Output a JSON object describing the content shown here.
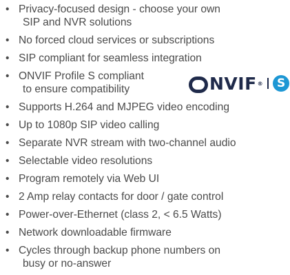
{
  "features": [
    {
      "lines": [
        "Privacy-focused design - choose your own",
        "SIP and NVR solutions"
      ]
    },
    {
      "lines": [
        "No forced cloud services or subscriptions"
      ]
    },
    {
      "lines": [
        "SIP compliant for seamless integration"
      ]
    },
    {
      "lines": [
        "ONVIF Profile S compliant",
        "to ensure compatibility"
      ],
      "logo": true
    },
    {
      "lines": [
        "Supports H.264 and MJPEG video encoding"
      ]
    },
    {
      "lines": [
        "Up to 1080p SIP video calling"
      ]
    },
    {
      "lines": [
        "Separate NVR stream with two-channel audio"
      ]
    },
    {
      "lines": [
        "Selectable video resolutions"
      ]
    },
    {
      "lines": [
        "Program remotely via Web UI"
      ]
    },
    {
      "lines": [
        "2 Amp relay contacts for door / gate control"
      ]
    },
    {
      "lines": [
        "Power-over-Ethernet (class 2, < 6.5 Watts)"
      ]
    },
    {
      "lines": [
        "Network downloadable firmware"
      ]
    },
    {
      "lines": [
        "Cycles through backup phone numbers on",
        "busy or no-answer"
      ]
    }
  ],
  "bullet": "•",
  "onvif_logo": {
    "text": "NVIF",
    "registered_mark": "®",
    "profile_letter": "S",
    "icon": "onvif-logo",
    "color_dark": "#1f2a4a",
    "color_badge": "#1d97d4"
  }
}
